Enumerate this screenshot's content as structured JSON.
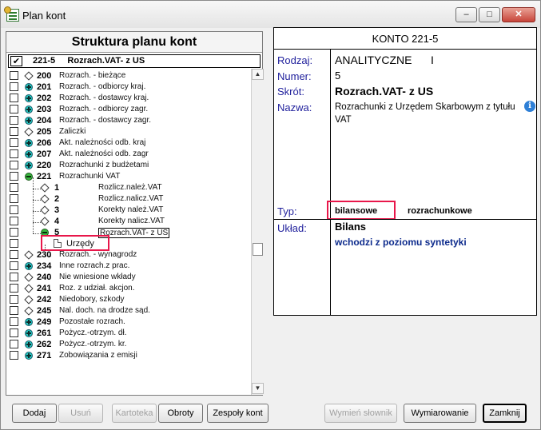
{
  "window": {
    "title": "Plan kont"
  },
  "caption_buttons": {
    "min": "–",
    "max": "□",
    "close": "✕"
  },
  "tree": {
    "header": "Struktura planu kont",
    "selected": {
      "check": "✔",
      "text": "221-5     Rozrach.VAT- z US"
    },
    "rows": [
      {
        "code": "200",
        "name": "Rozrach. - bieżące",
        "icon": "diamond"
      },
      {
        "code": "201",
        "name": "Rozrach. - odbiorcy kraj.",
        "icon": "plus"
      },
      {
        "code": "202",
        "name": "Rozrach. - dostawcy kraj.",
        "icon": "plus"
      },
      {
        "code": "203",
        "name": "Rozrach. - odbiorcy zagr.",
        "icon": "plus"
      },
      {
        "code": "204",
        "name": "Rozrach. - dostawcy zagr.",
        "icon": "plus"
      },
      {
        "code": "205",
        "name": "Zaliczki",
        "icon": "diamond"
      },
      {
        "code": "206",
        "name": "Akt. należności odb. kraj",
        "icon": "plus"
      },
      {
        "code": "207",
        "name": "Akt. należności odb. zagr",
        "icon": "plus"
      },
      {
        "code": "220",
        "name": "Rozrachunki z budżetami",
        "icon": "plus"
      },
      {
        "code": "221",
        "name": "Rozrachunki VAT",
        "icon": "minus"
      },
      {
        "code": "1",
        "name": "Rozlicz.należ.VAT",
        "icon": "diamond"
      },
      {
        "code": "2",
        "name": "Rozlicz.nalicz.VAT",
        "icon": "diamond"
      },
      {
        "code": "3",
        "name": "Korekty należ.VAT",
        "icon": "diamond"
      },
      {
        "code": "4",
        "name": "Korekty nalicz.VAT",
        "icon": "diamond"
      },
      {
        "code": "5",
        "name": "Rozrach.VAT- z US",
        "icon": "minus"
      },
      {
        "code": "",
        "name": "Urzędy",
        "icon": "doc"
      },
      {
        "code": "230",
        "name": "Rozrach. - wynagrodz",
        "icon": "diamond"
      },
      {
        "code": "234",
        "name": "Inne rozrach.z prac.",
        "icon": "plus"
      },
      {
        "code": "240",
        "name": "Nie wniesione wkłady",
        "icon": "diamond"
      },
      {
        "code": "241",
        "name": "Roz. z udział. akcjon.",
        "icon": "diamond"
      },
      {
        "code": "242",
        "name": "Niedobory, szkody",
        "icon": "diamond"
      },
      {
        "code": "245",
        "name": "Nal. doch. na drodze sąd.",
        "icon": "diamond"
      },
      {
        "code": "249",
        "name": "Pozostałe rozrach.",
        "icon": "plus"
      },
      {
        "code": "261",
        "name": "Pożycz.-otrzym. dł.",
        "icon": "plus"
      },
      {
        "code": "262",
        "name": "Pożycz.-otrzym. kr.",
        "icon": "plus"
      },
      {
        "code": "271",
        "name": "Zobowiązania z emisji",
        "icon": "plus"
      }
    ],
    "scroll_up": "▲",
    "scroll_down": "▼"
  },
  "detail": {
    "header": "KONTO  221-5",
    "labels": {
      "rodzaj": "Rodzaj:",
      "numer": "Numer:",
      "skrot": "Skrót:",
      "nazwa": "Nazwa:",
      "typ": "Typ:",
      "uklad": "Układ:"
    },
    "values": {
      "rodzaj": "ANALITYCZNE",
      "rodzaj_level": "I",
      "numer": "5",
      "skrot": "Rozrach.VAT- z US",
      "nazwa": "Rozrachunki z Urzędem Skarbowym z tytułu VAT",
      "typ_1": "bilansowe",
      "typ_2": "rozrachunkowe",
      "uklad": "Bilans",
      "uklad_desc": "wchodzi z poziomu syntetyki"
    },
    "info_icon": "i"
  },
  "buttons": {
    "dodaj": "Dodaj",
    "usun": "Usuń",
    "kartoteka": "Kartoteka",
    "obroty": "Obroty",
    "zespoly": "Zespoły kont",
    "wymien": "Wymień słownik",
    "wymiarowanie": "Wymiarowanie",
    "zamknij": "Zamknij"
  },
  "colors": {
    "highlight": "#e8174a",
    "label": "#1f1f9c",
    "uklad_desc": "#0c2a8c"
  }
}
